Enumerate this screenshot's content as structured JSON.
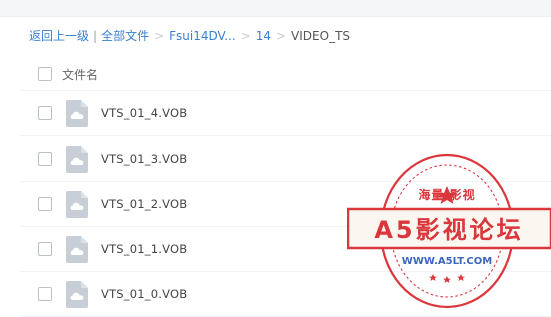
{
  "breadcrumb": {
    "back": "返回上一级",
    "all_files": "全部文件",
    "path": [
      "Fsui14DV...",
      "14"
    ],
    "current": "VIDEO_TS"
  },
  "list": {
    "column_name": "文件名",
    "files": [
      {
        "name": "VTS_01_4.VOB"
      },
      {
        "name": "VTS_01_3.VOB"
      },
      {
        "name": "VTS_01_2.VOB"
      },
      {
        "name": "VTS_01_1.VOB"
      },
      {
        "name": "VTS_01_0.VOB"
      }
    ]
  },
  "watermark": {
    "top_text": "海量 影视",
    "main_text": "A5影视论坛",
    "url": "WWW.A5LT.COM"
  },
  "colors": {
    "link": "#3a7fd5",
    "stamp_red": "#d9262c",
    "file_icon": "#c7ced6"
  }
}
